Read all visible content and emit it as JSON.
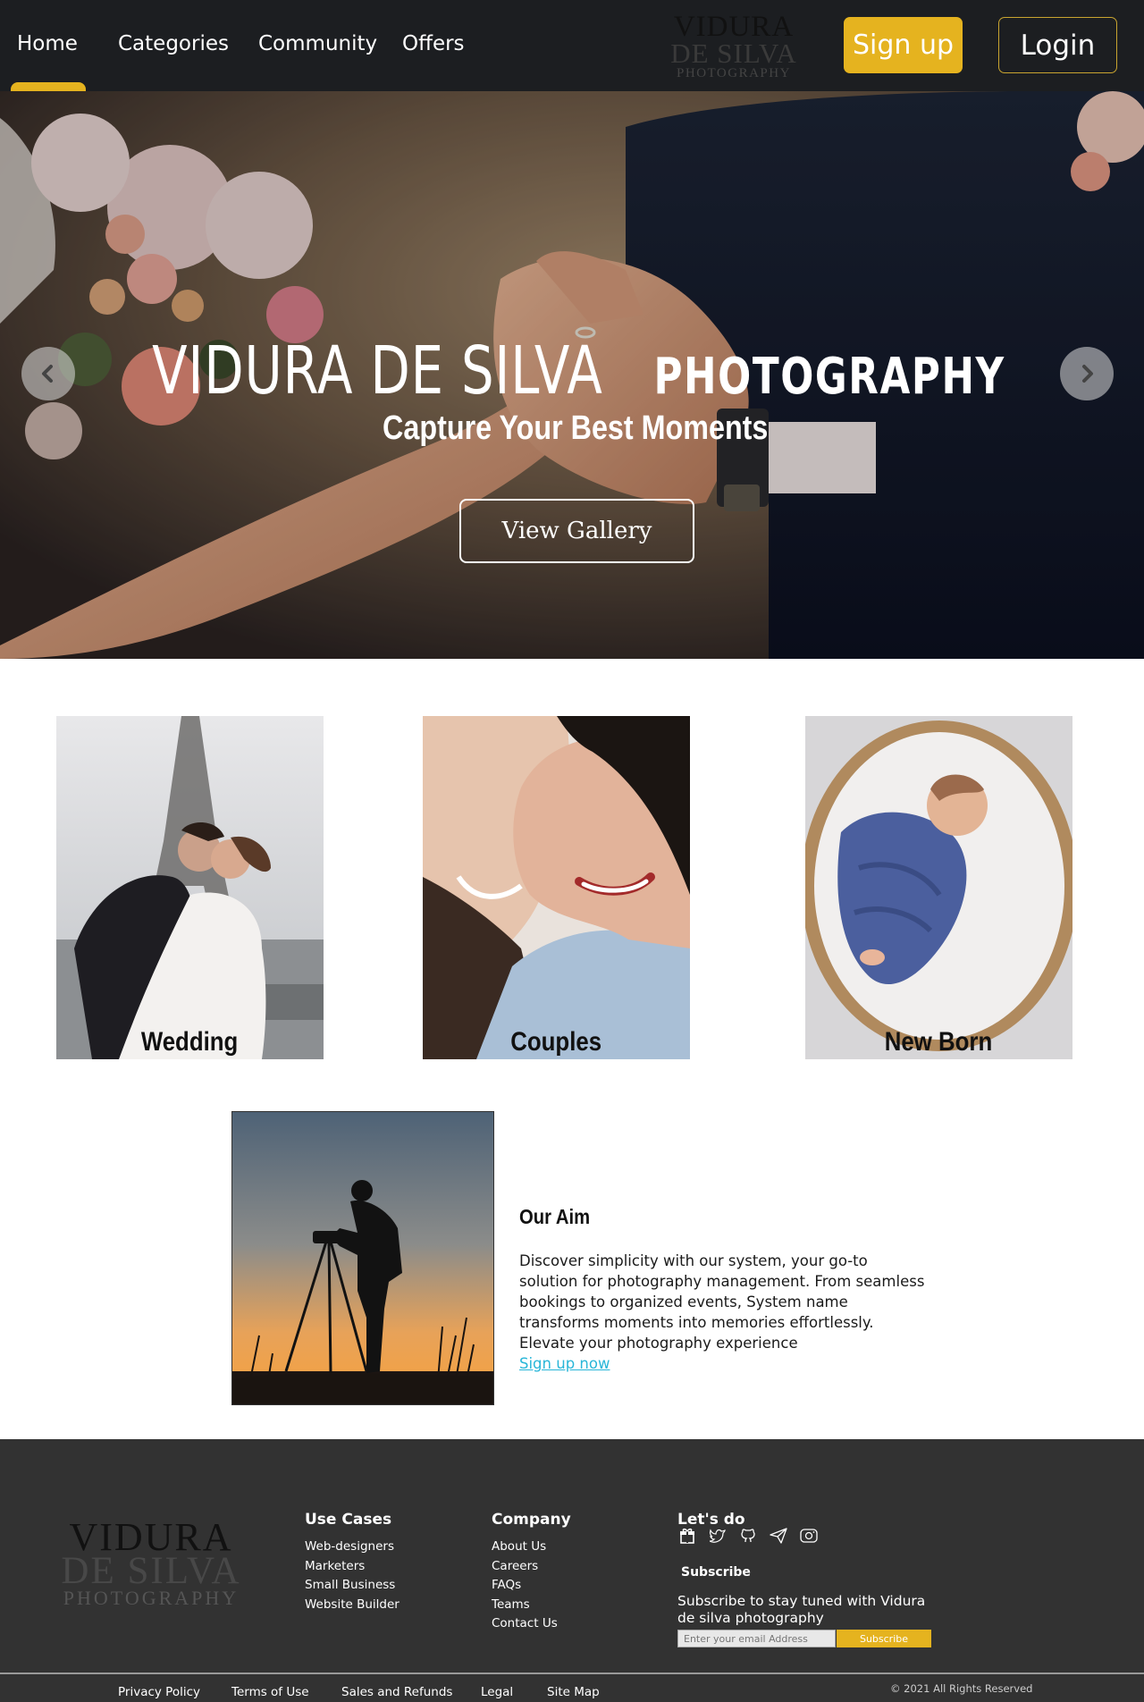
{
  "nav": {
    "links": [
      "Home",
      "Categories",
      "Community",
      "Offers"
    ],
    "active": "Home",
    "signup_label": "Sign up",
    "login_label": "Login"
  },
  "brand": {
    "line1": "VIDURA",
    "line2": "DE SILVA",
    "line3": "PHOTOGRAPHY"
  },
  "hero": {
    "title_main": "VIDURA DE SILVA",
    "title_suffix": "PHOTOGRAPHY",
    "subtitle": "Capture Your Best Moments",
    "gallery_button": "View Gallery",
    "prev_icon": "chevron-left-icon",
    "next_icon": "chevron-right-icon"
  },
  "categories": [
    {
      "label": "Wedding"
    },
    {
      "label": "Couples"
    },
    {
      "label": "New Born"
    }
  ],
  "aim": {
    "title": "Our Aim",
    "text": "Discover simplicity with our system, your go-to solution for photography management. From seamless bookings to organized events, System name transforms moments into memories effortlessly. Elevate your photography experience",
    "link": "Sign up now"
  },
  "footer": {
    "use_cases": {
      "title": "Use Cases",
      "items": [
        "Web-designers",
        "Marketers",
        "Small Business",
        "Website Builder"
      ]
    },
    "company": {
      "title": "Company",
      "items": [
        "About Us",
        "Careers",
        "FAQs",
        "Teams",
        "Contact Us"
      ]
    },
    "lets_do": {
      "title": "Let's do",
      "icons": [
        "gift-icon",
        "twitter-icon",
        "github-icon",
        "send-icon",
        "instagram-icon"
      ]
    },
    "subscribe": {
      "title": "Subscribe",
      "text": "Subscribe to stay tuned with Vidura de silva photography",
      "placeholder": "Enter your email Address",
      "button": "Subscribe"
    },
    "bottom_links": [
      "Privacy Policy",
      "Terms of Use",
      "Sales and Refunds",
      "Legal",
      "Site Map"
    ],
    "copyright": "© 2021 All Rights Reserved"
  },
  "colors": {
    "accent": "#e5b31f",
    "nav_bg": "#1c1e21",
    "footer_bg": "#323232",
    "link": "#29b6d8"
  }
}
